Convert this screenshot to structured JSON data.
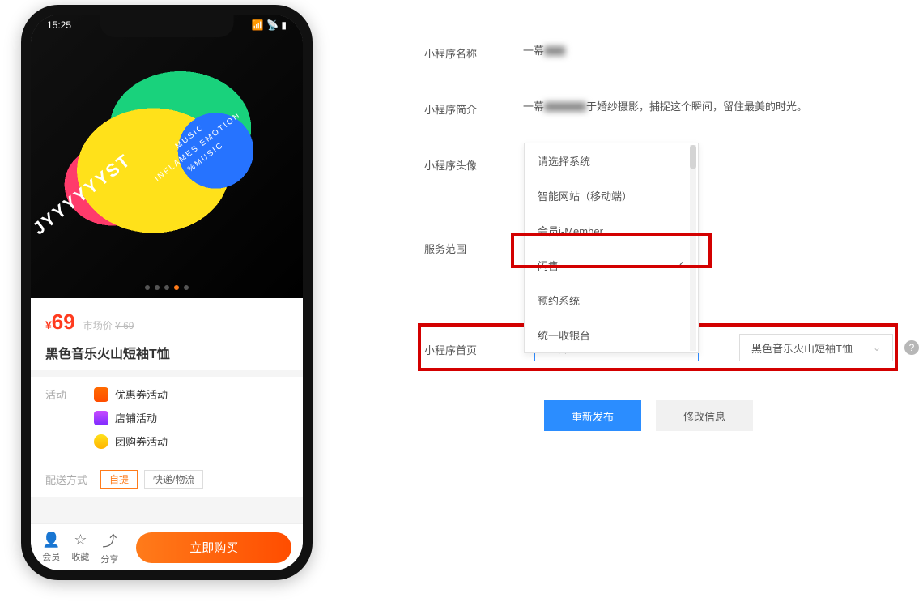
{
  "phone": {
    "time": "15:25",
    "image_brand": "JYYYYYYST",
    "image_overlay_1": "MUSIC",
    "image_overlay_2": "INFLAMES EMOTION",
    "image_overlay_3": "%MUSIC",
    "price_prefix": "¥",
    "price": "69",
    "market_label": "市场价",
    "market_value": "¥ 69",
    "title": "黑色音乐火山短袖T恤",
    "activity_label": "活动",
    "activities": [
      {
        "icon": "ic-coupon",
        "text": "优惠券活动"
      },
      {
        "icon": "ic-shop",
        "text": "店铺活动"
      },
      {
        "icon": "ic-group",
        "text": "团购券活动"
      }
    ],
    "delivery_label": "配送方式",
    "delivery_tags": [
      "自提",
      "快递/物流"
    ],
    "bottom": [
      "会员",
      "收藏",
      "分享"
    ],
    "buy": "立即购买"
  },
  "form": {
    "name_label": "小程序名称",
    "name_value": "一幕",
    "intro_label": "小程序简介",
    "intro_value_pre": "一幕",
    "intro_value_post": "于婚纱摄影，捕捉这个瞬间，留住最美的时光。",
    "avatar_label": "小程序头像",
    "scope_label": "服务范围",
    "homepage_label": "小程序首页",
    "dropdown": {
      "placeholder": "请选择系统",
      "options": [
        "智能网站（移动端）",
        "会员i-Member",
        "闪售",
        "预约系统",
        "统一收银台"
      ],
      "selected_index": 2
    },
    "homepage_select1": "闪售",
    "homepage_select2": "黑色音乐火山短袖T恤",
    "republish": "重新发布",
    "modify": "修改信息"
  }
}
